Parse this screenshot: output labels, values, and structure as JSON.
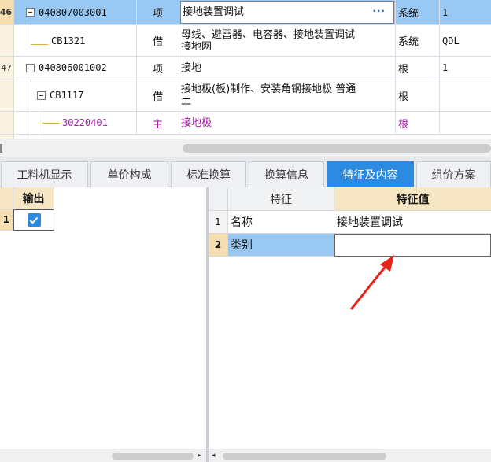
{
  "top_grid": {
    "rows": [
      {
        "num": "46",
        "code": "040807003001",
        "type": "项",
        "name": "接地装置调试",
        "unit": "系统",
        "qty": "1",
        "edit_button": "···"
      },
      {
        "num": "",
        "code": "CB1321",
        "type": "借",
        "name_line1": "母线、避雷器、电容器、接地装置调试",
        "name_line2": "接地网",
        "unit": "系统",
        "qty": "QDL"
      },
      {
        "num": "47",
        "code": "040806001002",
        "type": "项",
        "name": "接地",
        "unit": "根",
        "qty": "1"
      },
      {
        "num": "",
        "code": "CB1117",
        "type": "借",
        "name_line1": "接地极(板)制作、安装角钢接地极 普通",
        "name_line2": "土",
        "unit": "根",
        "qty": ""
      },
      {
        "num": "",
        "code": "30220401",
        "type": "主",
        "name": "接地极",
        "unit": "根",
        "qty": ""
      }
    ]
  },
  "tabs": [
    {
      "label": "工料机显示",
      "active": false
    },
    {
      "label": "单价构成",
      "active": false
    },
    {
      "label": "标准换算",
      "active": false
    },
    {
      "label": "换算信息",
      "active": false
    },
    {
      "label": "特征及内容",
      "active": true
    },
    {
      "label": "组价方案",
      "active": false
    }
  ],
  "output_panel": {
    "header": "输出",
    "rows": [
      {
        "num": "1",
        "checked": true
      }
    ]
  },
  "feature_panel": {
    "col_feature": "特征",
    "col_value": "特征值",
    "rows": [
      {
        "num": "1",
        "feature": "名称",
        "value": "接地装置调试"
      },
      {
        "num": "2",
        "feature": "类别",
        "value": ""
      }
    ]
  },
  "colors": {
    "selected_row": "#99c9f3",
    "active_tab": "#2c8ae0",
    "header_bg": "#f6e6c4",
    "annotation_arrow": "#e8231b",
    "material_text": "#a020a0"
  }
}
